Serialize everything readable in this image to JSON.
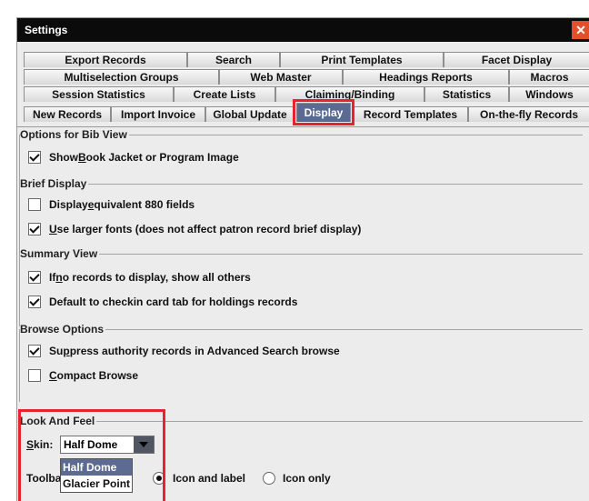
{
  "window": {
    "title": "Settings",
    "close_glyph": "✕"
  },
  "tabs": {
    "row1": [
      "Export Records",
      "Search",
      "Print Templates",
      "Facet Display"
    ],
    "row2": [
      "Multiselection Groups",
      "Web Master",
      "Headings Reports",
      "Macros"
    ],
    "row3": [
      "Session Statistics",
      "Create Lists",
      "Claiming/Binding",
      "Statistics",
      "Windows"
    ],
    "row4": [
      "New Records",
      "Import Invoice",
      "Global Update",
      "Display",
      "Record Templates",
      "On-the-fly Records"
    ],
    "active": "Display"
  },
  "bib_view": {
    "title": "Options for Bib View",
    "show_jacket": {
      "pre": "Show ",
      "u": "B",
      "post": "ook Jacket or Program Image",
      "checked": true
    }
  },
  "brief_display": {
    "title": "Brief Display",
    "equiv_880": {
      "pre": "Display ",
      "u": "e",
      "post": "quivalent 880 fields",
      "checked": false
    },
    "larger_fonts": {
      "pre": "",
      "u": "U",
      "post": "se larger fonts (does not affect patron record brief display)",
      "checked": true
    }
  },
  "summary_view": {
    "title": "Summary View",
    "no_records": {
      "pre": "If ",
      "u": "n",
      "post": "o records to display, show all others",
      "checked": true
    },
    "checkin_default": {
      "pre": "Default to checkin card tab for holdings records",
      "u": "",
      "post": "",
      "checked": true
    }
  },
  "browse_options": {
    "title": "Browse Options",
    "suppress_authority": {
      "pre": "Su",
      "u": "p",
      "post": "press authority records in Advanced Search browse",
      "checked": true
    },
    "compact_browse": {
      "pre": "",
      "u": "C",
      "post": "ompact Browse",
      "checked": false
    }
  },
  "look_and_feel": {
    "title": "Look And Feel",
    "skin_label_u": "S",
    "skin_label_rest": "kin:",
    "skin_value": "Half Dome",
    "skin_options": [
      "Half Dome",
      "Glacier Point"
    ],
    "toolbar_label": "Toolba",
    "radio_icon_label": "Icon and label",
    "radio_icon_only": "Icon only"
  },
  "colors": {
    "accent_red": "#e8222f",
    "tab_active": "#5b6a93"
  }
}
